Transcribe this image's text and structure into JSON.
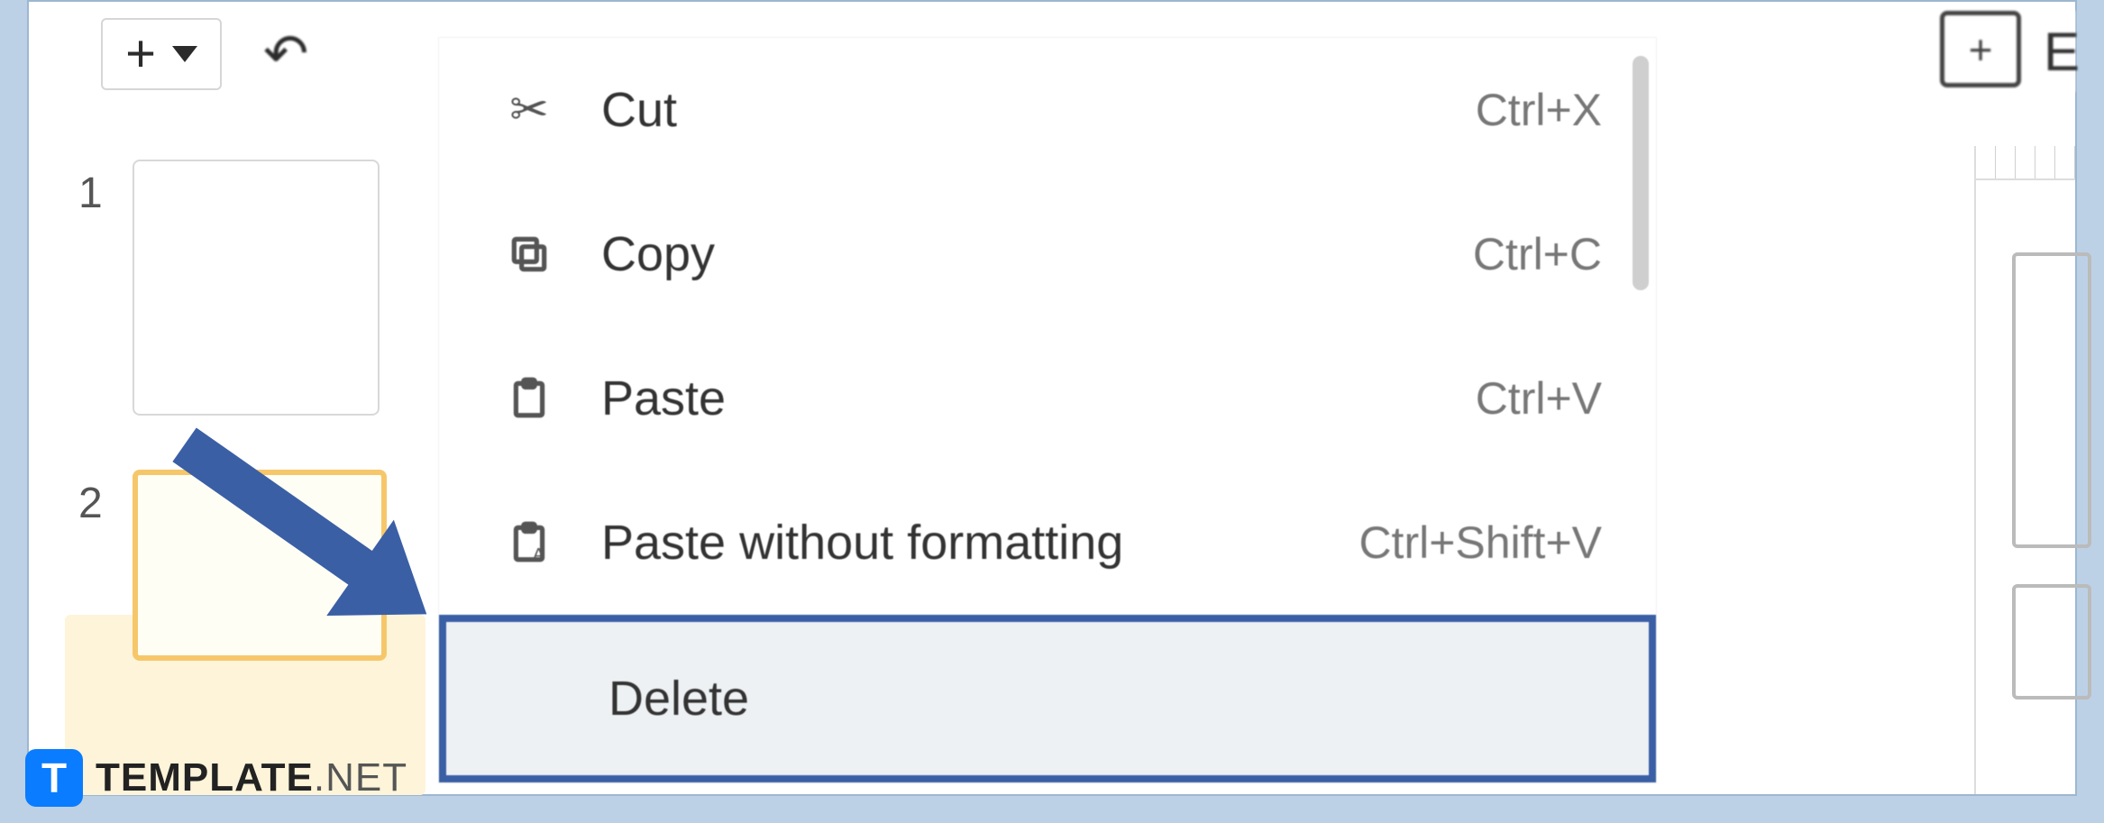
{
  "toolbar": {
    "add_label": "+"
  },
  "thumbs": {
    "slide1_num": "1",
    "slide2_num": "2"
  },
  "context_menu": {
    "items": [
      {
        "label": "Cut",
        "shortcut": "Ctrl+X"
      },
      {
        "label": "Copy",
        "shortcut": "Ctrl+C"
      },
      {
        "label": "Paste",
        "shortcut": "Ctrl+V"
      },
      {
        "label": "Paste without formatting",
        "shortcut": "Ctrl+Shift+V"
      },
      {
        "label": "Delete",
        "shortcut": ""
      }
    ]
  },
  "watermark": {
    "badge": "T",
    "brand": "TEMPLATE",
    "suffix": ".NET"
  }
}
